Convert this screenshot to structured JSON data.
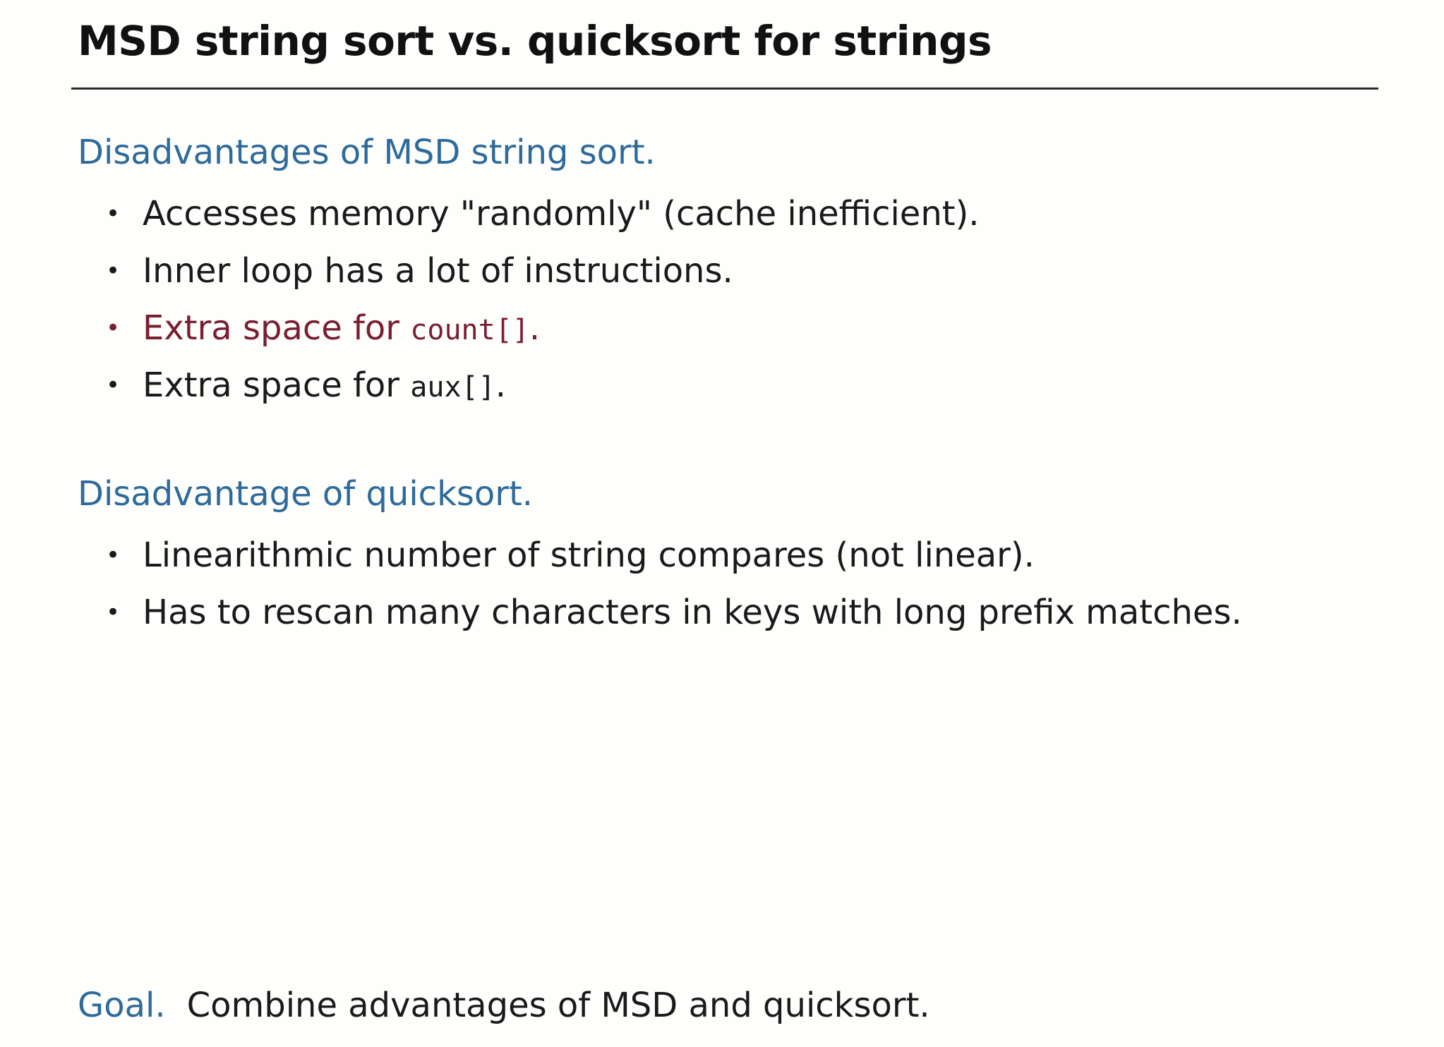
{
  "title": "MSD string sort vs. quicksort for strings",
  "section1": {
    "heading": "Disadvantages of MSD string sort.",
    "items": [
      {
        "text": "Accesses memory \"randomly\" (cache inefficient).",
        "code": "",
        "suffix": ""
      },
      {
        "text": "Inner loop has a lot of instructions.",
        "code": "",
        "suffix": ""
      },
      {
        "text": "Extra space for ",
        "code": "count[]",
        "suffix": "."
      },
      {
        "text": "Extra space for ",
        "code": "aux[]",
        "suffix": "."
      }
    ]
  },
  "section2": {
    "heading": "Disadvantage of quicksort.",
    "items": [
      {
        "text": "Linearithmic number of string compares (not linear)."
      },
      {
        "text": "Has to rescan many characters in keys with long prefix matches."
      }
    ]
  },
  "goal": {
    "label": "Goal.",
    "text": "Combine advantages of MSD and quicksort."
  },
  "bullet_glyph": "•",
  "colors": {
    "heading": "#2e6a9a",
    "highlight": "#7a1e30",
    "text": "#1a1a1a",
    "background": "#fefefc"
  }
}
